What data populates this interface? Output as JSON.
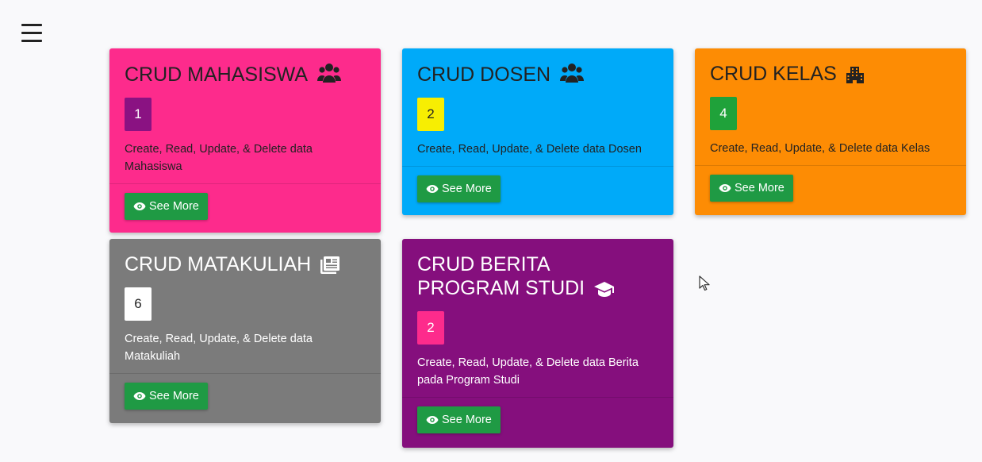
{
  "menu": {
    "icon": "hamburger-menu-icon"
  },
  "cards": [
    {
      "title": "CRUD MAHASISWA",
      "icon": "users-icon",
      "count": "1",
      "description": "Create, Read, Update, & Delete data Mahasiswa",
      "button": "See More",
      "colors": {
        "bg": "#fd2b8c",
        "badge": "#8a1282",
        "badge_text": "#ffffff",
        "text": "#222222"
      }
    },
    {
      "title": "CRUD DOSEN",
      "icon": "users-icon",
      "count": "2",
      "description": "Create, Read, Update, & Delete data Dosen",
      "button": "See More",
      "colors": {
        "bg": "#00aaf9",
        "badge": "#f7ee02",
        "badge_text": "#222222",
        "text": "#222222"
      }
    },
    {
      "title": "CRUD KELAS",
      "icon": "building-icon",
      "count": "4",
      "description": "Create, Read, Update, & Delete data Kelas",
      "button": "See More",
      "colors": {
        "bg": "#fd8c04",
        "badge": "#1fa23a",
        "badge_text": "#ffffff",
        "text": "#222222"
      }
    },
    {
      "title": "CRUD MATAKULIAH",
      "icon": "book-icon",
      "count": "6",
      "description": "Create, Read, Update, & Delete data Matakuliah",
      "button": "See More",
      "colors": {
        "bg": "#7b7b7b",
        "badge": "#ffffff",
        "badge_text": "#222222",
        "text": "#ffffff"
      }
    },
    {
      "title": "CRUD BERITA PROGRAM STUDI",
      "icon": "graduation-cap-icon",
      "count": "2",
      "description": "Create, Read, Update, & Delete data Berita pada Program Studi",
      "button": "See More",
      "colors": {
        "bg": "#850f7d",
        "badge": "#fd2b8c",
        "badge_text": "#ffffff",
        "text": "#ffffff"
      }
    }
  ]
}
